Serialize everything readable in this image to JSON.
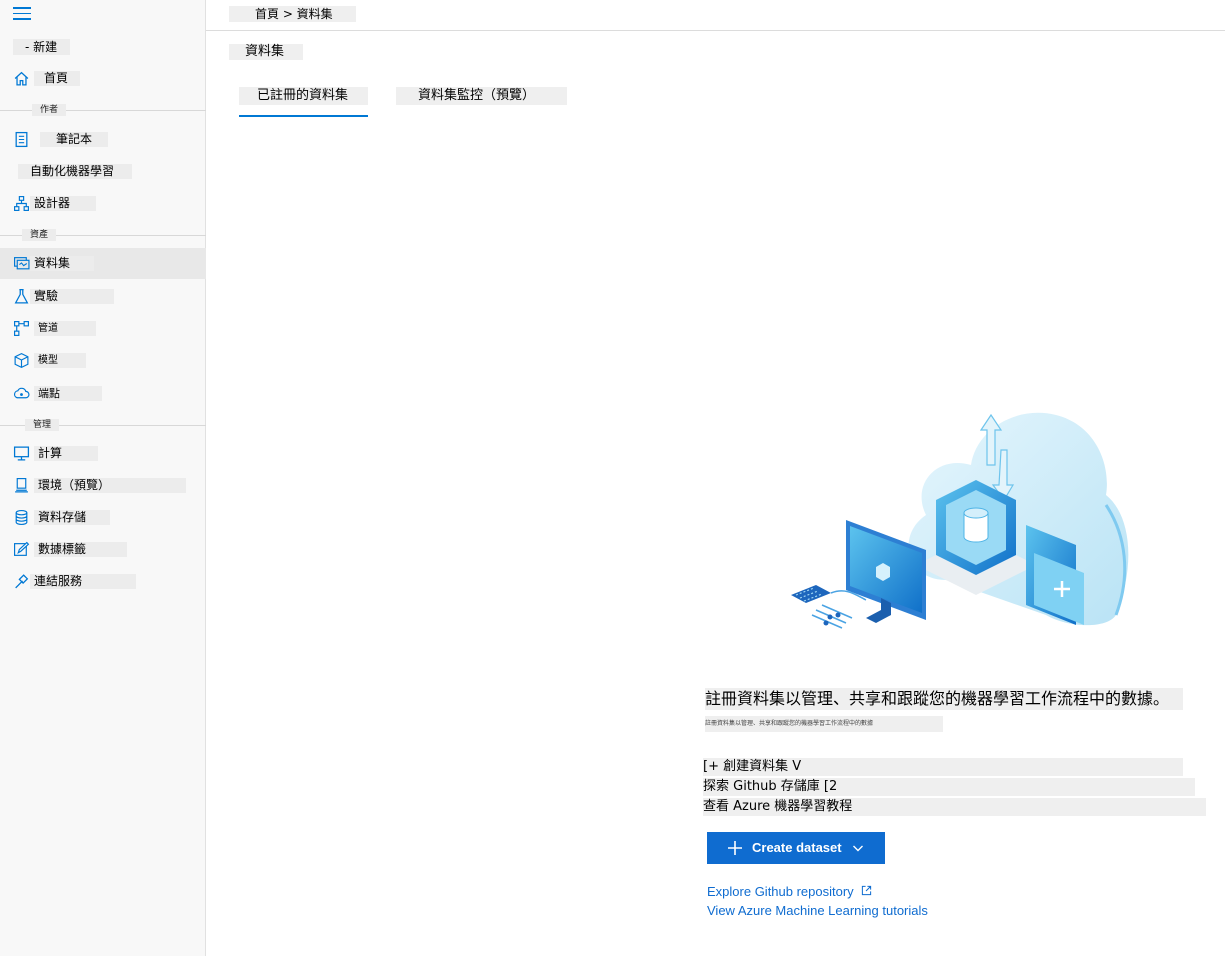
{
  "sidebar": {
    "new_label": "- 新建",
    "home": "首頁",
    "sections": {
      "author": "作者",
      "assets": "資產",
      "manage": "管理"
    },
    "author_items": [
      "筆記本",
      "自動化機器學習",
      "設計器"
    ],
    "asset_items": [
      "資料集",
      "實驗",
      "管道",
      "模型",
      "端點"
    ],
    "manage_items": [
      "計算",
      "環境（預覽）",
      "資料存儲",
      "數據標籤",
      "連結服務"
    ]
  },
  "header": {
    "breadcrumb": "首頁 > 資料集"
  },
  "main": {
    "title": "資料集",
    "tabs": [
      "已註冊的資料集",
      "資料集監控（預覽）"
    ],
    "description": "註冊資料集以管理、共享和跟蹤您的機器學習工作流程中的數據。",
    "description_sub": "註冊資料集以管理、共享和跟蹤您的機器學習工作流程中的數據",
    "translated_lines": [
      "[+ 創建資料集 V",
      "探索 Github 存儲庫 [2",
      "查看 Azure 機器學習教程"
    ],
    "create_button": "Create dataset",
    "links": {
      "github": "Explore Github repository",
      "tutorials": "View Azure Machine Learning tutorials"
    }
  },
  "colors": {
    "accent": "#0078d4",
    "button": "#0f6cd0",
    "sidebar_bg": "#f8f8f8"
  },
  "icons": [
    "hamburger-icon",
    "home-icon",
    "notebook-icon",
    "designer-icon",
    "dataset-icon",
    "flask-icon",
    "pipeline-icon",
    "cube-icon",
    "endpoint-icon",
    "compute-icon",
    "environment-icon",
    "datastore-icon",
    "labeling-icon",
    "link-icon",
    "plus-icon",
    "chevron-down-icon",
    "external-link-icon"
  ]
}
